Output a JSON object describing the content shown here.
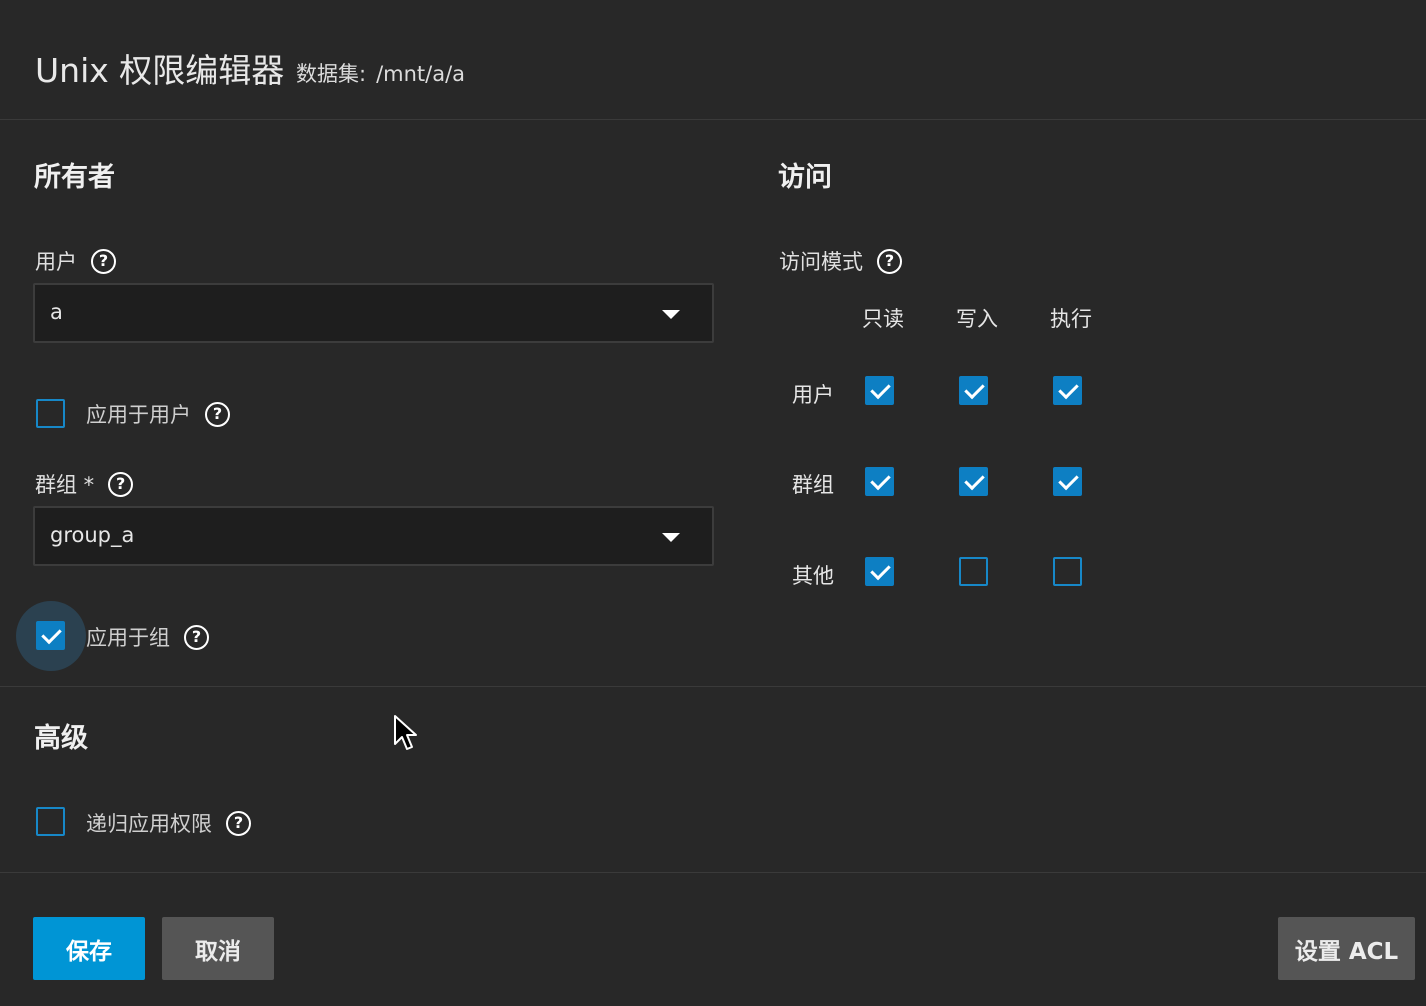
{
  "header": {
    "title": "Unix 权限编辑器",
    "dataset_label": "数据集:",
    "dataset_path": "/mnt/a/a"
  },
  "owner": {
    "section_title": "所有者",
    "user_label": "用户",
    "user_value": "a",
    "apply_user_label": "应用于用户",
    "apply_user_checked": false,
    "group_label": "群组 *",
    "group_value": "group_a",
    "apply_group_label": "应用于组",
    "apply_group_checked": true
  },
  "access": {
    "section_title": "访问",
    "mode_label": "访问模式",
    "columns": [
      "只读",
      "写入",
      "执行"
    ],
    "rows": [
      {
        "label": "用户",
        "values": [
          true,
          true,
          true
        ]
      },
      {
        "label": "群组",
        "values": [
          true,
          true,
          true
        ]
      },
      {
        "label": "其他",
        "values": [
          true,
          false,
          false
        ]
      }
    ]
  },
  "advanced": {
    "section_title": "高级",
    "recursive_label": "递归应用权限",
    "recursive_checked": false
  },
  "actions": {
    "save_label": "保存",
    "cancel_label": "取消",
    "set_acl_label": "设置 ACL"
  },
  "colors": {
    "accent": "#0095d5",
    "checkbox": "#0d7fc3",
    "background": "#282828"
  },
  "icons": {
    "help": "help-circle-icon",
    "dropdown": "chevron-down-icon",
    "check": "check-icon",
    "cursor": "mouse-pointer-icon"
  }
}
